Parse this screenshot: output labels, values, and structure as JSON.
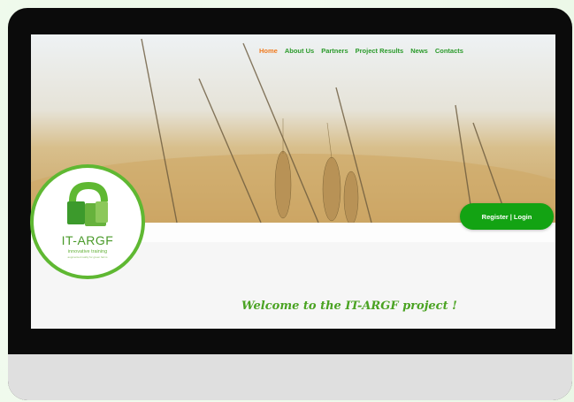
{
  "nav": {
    "items": [
      {
        "label": "Home",
        "active": true
      },
      {
        "label": "About Us",
        "active": false
      },
      {
        "label": "Partners",
        "active": false
      },
      {
        "label": "Project Results",
        "active": false
      },
      {
        "label": "News",
        "active": false
      },
      {
        "label": "Contacts",
        "active": false
      }
    ]
  },
  "register_button": "Register | Login",
  "welcome_text": "Welcome to the IT-ARGF project !",
  "logo": {
    "title": "IT-ARGF",
    "subtitle": "innovative training",
    "tagline": "augmented reality for green farms"
  },
  "colors": {
    "accent_green": "#13a313",
    "nav_green": "#2a9a2a",
    "nav_active": "#f07a1e",
    "logo_green": "#5fb832"
  },
  "icons": [
    "logo-mark-icon"
  ]
}
